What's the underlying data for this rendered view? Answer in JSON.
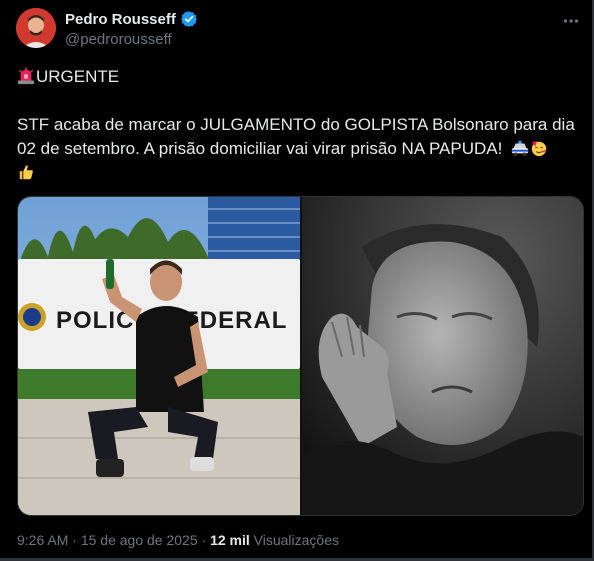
{
  "author": {
    "display_name": "Pedro Rousseff",
    "handle": "@pedrorousseff",
    "verified": true
  },
  "icons": {
    "more": "more-horizontal-icon",
    "verified": "verified-badge-icon",
    "siren": "siren-emoji",
    "police_car": "police-car-emoji",
    "party_face": "partying-face-emoji",
    "thumbs_up": "thumbs-up-emoji"
  },
  "tweet": {
    "line1": "URGENTE",
    "line2": "STF acaba de marcar o JULGAMENTO do GOLPISTA Bolsonaro para dia",
    "line3": "02 de setembro. A prisão domiciliar vai virar prisão NA PAPUDA!"
  },
  "media": {
    "left_sign": "POLICIA FEDERAL"
  },
  "meta": {
    "time": "9:26 AM",
    "separator": "·",
    "date": "15 de ago de 2025",
    "views_count": "12 mil",
    "views_label": "Visualizações"
  },
  "colors": {
    "background": "#000000",
    "text": "#e7e9ea",
    "secondary": "#71767b",
    "verified": "#1d9bf0"
  }
}
